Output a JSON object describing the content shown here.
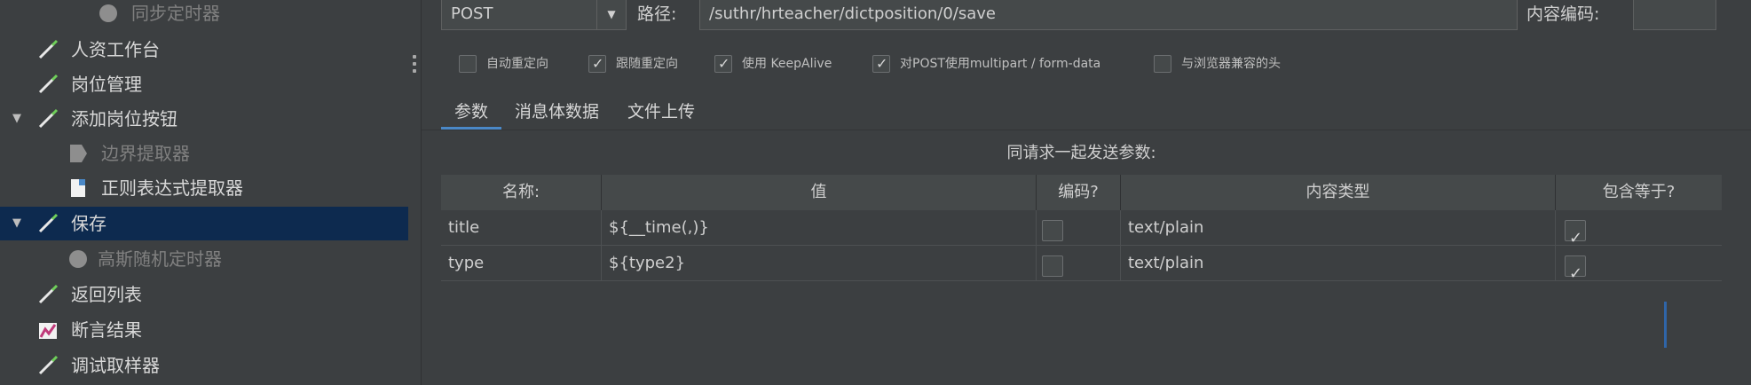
{
  "tree": {
    "items": [
      {
        "label": "同步定时器",
        "icon": "timer-icon",
        "disabled": true
      },
      {
        "label": "人资工作台",
        "icon": "pipette-icon",
        "disabled": false
      },
      {
        "label": "岗位管理",
        "icon": "pipette-icon",
        "disabled": false
      },
      {
        "label": "添加岗位按钮",
        "icon": "pipette-icon",
        "disabled": false,
        "expanded": true
      },
      {
        "label": "边界提取器",
        "icon": "extractor-icon",
        "disabled": true
      },
      {
        "label": "正则表达式提取器",
        "icon": "document-icon",
        "disabled": false
      },
      {
        "label": "保存",
        "icon": "pipette-icon",
        "disabled": false,
        "expanded": true,
        "selected": true
      },
      {
        "label": "高斯随机定时器",
        "icon": "timer-icon",
        "disabled": true
      },
      {
        "label": "返回列表",
        "icon": "pipette-icon",
        "disabled": false
      },
      {
        "label": "断言结果",
        "icon": "chart-icon",
        "disabled": false
      },
      {
        "label": "调试取样器",
        "icon": "pipette-icon",
        "disabled": false
      }
    ]
  },
  "request": {
    "method": "POST",
    "path_label": "路径:",
    "path_value": "/suthr/hrteacher/dictposition/0/save",
    "encoding_label": "内容编码:",
    "encoding_value": ""
  },
  "options": [
    {
      "label": "自动重定向",
      "checked": false
    },
    {
      "label": "跟随重定向",
      "checked": true
    },
    {
      "label": "使用 KeepAlive",
      "checked": true
    },
    {
      "label": "对POST使用multipart / form-data",
      "checked": true
    },
    {
      "label": "与浏览器兼容的头",
      "checked": false
    }
  ],
  "tabs": [
    {
      "label": "参数",
      "active": true
    },
    {
      "label": "消息体数据",
      "active": false
    },
    {
      "label": "文件上传",
      "active": false
    }
  ],
  "params": {
    "caption": "同请求一起发送参数:",
    "headers": [
      "名称:",
      "值",
      "编码?",
      "内容类型",
      "包含等于?"
    ],
    "rows": [
      {
        "name": "title",
        "value": "${__time(,)}",
        "encode": false,
        "content_type": "text/plain",
        "include_equals": true
      },
      {
        "name": "type",
        "value": "${type2}",
        "encode": false,
        "content_type": "text/plain",
        "include_equals": true
      }
    ]
  },
  "colors": {
    "selection": "#0d2a4f",
    "background": "#3c3f41",
    "accent": "#4a88c7"
  }
}
